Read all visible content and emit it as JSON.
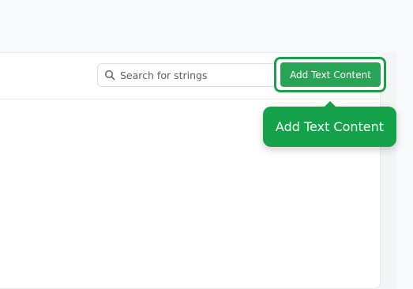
{
  "search": {
    "placeholder": "Search for strings",
    "value": ""
  },
  "toolbar": {
    "add_label": "Add Text Content"
  },
  "tooltip": {
    "text": "Add Text Content"
  },
  "colors": {
    "accent": "#27a554",
    "tooltip_bg": "#16a24a",
    "highlight_ring": "#1e9e4c",
    "page_bg": "#f8f9fb"
  },
  "icons": {
    "search": "search-icon"
  }
}
